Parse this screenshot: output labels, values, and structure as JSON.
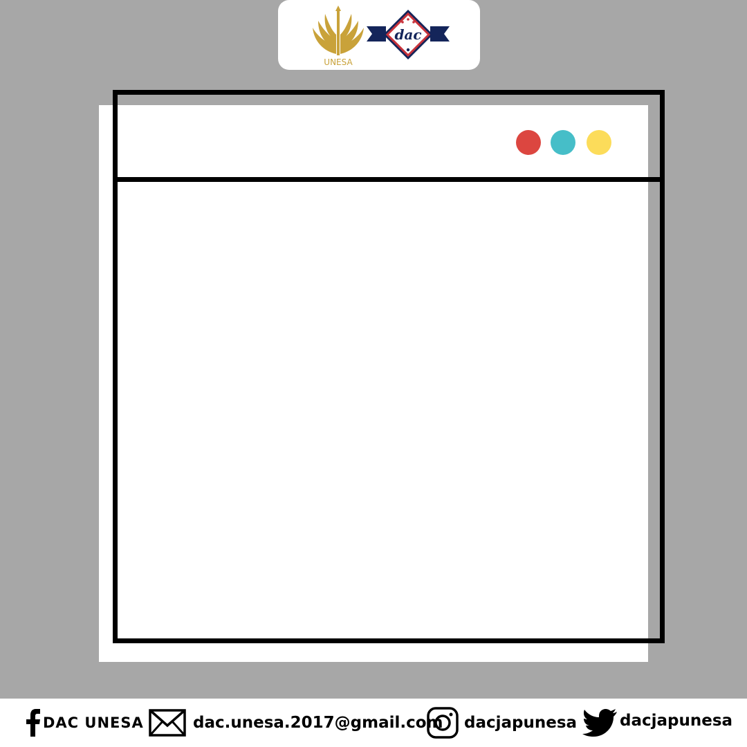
{
  "header": {
    "logos": [
      {
        "name": "unesa-logo",
        "text": "UNESA",
        "color": "#c9a23a"
      },
      {
        "name": "dac-logo",
        "text": "dac",
        "color": "#c8323a"
      }
    ]
  },
  "window": {
    "controls": [
      {
        "name": "red-dot",
        "color": "#dc4640"
      },
      {
        "name": "teal-dot",
        "color": "#46bec8"
      },
      {
        "name": "yellow-dot",
        "color": "#fcdc5a"
      }
    ]
  },
  "footer": {
    "facebook": {
      "icon": "facebook-icon",
      "label": "DAC UNESA"
    },
    "email": {
      "icon": "mail-icon",
      "label": "dac.unesa.2017@gmail.com"
    },
    "instagram": {
      "icon": "instagram-icon",
      "label": "dacjapunesa"
    },
    "twitter": {
      "icon": "twitter-icon",
      "label": "dacjapunesa"
    }
  },
  "colors": {
    "background": "#a7a7a7",
    "paper": "#ffffff",
    "frame": "#000000"
  }
}
